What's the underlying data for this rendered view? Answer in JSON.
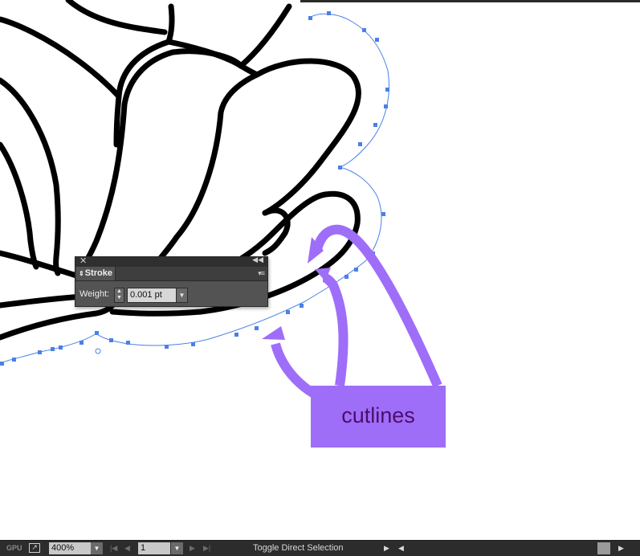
{
  "stroke_panel": {
    "close_icon": "close-icon",
    "collapse_icon": "double-chevron-left-icon",
    "tab_label": "Stroke",
    "tab_arrows_icon": "updown-arrows-icon",
    "menu_icon": "panel-menu-icon",
    "weight_label": "Weight:",
    "weight_value": "0.001 pt"
  },
  "annotation": {
    "label": "cutlines",
    "box_color": "#9f6ef8",
    "text_color": "#4a0e6e"
  },
  "path_color": "#4a80e8",
  "status_bar": {
    "zoom_value": "400%",
    "page_value": "1",
    "status_text": "Toggle Direct Selection"
  }
}
